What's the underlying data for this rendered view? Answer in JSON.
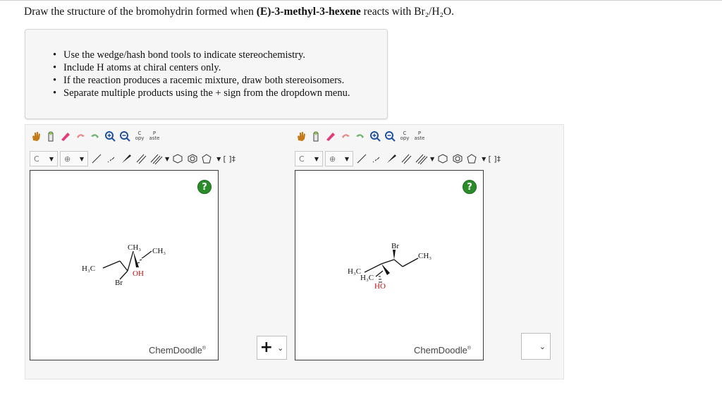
{
  "question": {
    "prefix": "Draw the structure of the bromohydrin formed when ",
    "compound": "(E)-3-methyl-3-hexene",
    "suffix": " reacts with Br₂/H₂O."
  },
  "instructions": [
    "Use the wedge/hash bond tools to indicate stereochemistry.",
    "Include H atoms at chiral centers only.",
    "If the reaction produces a racemic mixture, draw both stereoisomers.",
    "Separate multiple products using the + sign from the dropdown menu."
  ],
  "toolbar": {
    "element_select": "C",
    "charge_symbol": "⊕",
    "copy_top": "C",
    "copy_bottom": "opy",
    "paste_top": "P",
    "paste_bottom": "aste",
    "bracket": "[ ]‡"
  },
  "editor": {
    "help_label": "?",
    "brand": "ChemDoodle",
    "brand_mark": "®"
  },
  "molecule1": {
    "ch3_top": "CH₃",
    "ch3_right": "CH₃",
    "h3c_left": "H₃C",
    "oh": "OH",
    "br": "Br"
  },
  "molecule2": {
    "br": "Br",
    "ch3_right": "CH₃",
    "h3c_left": "H₃C",
    "h3c_inner": "H₃C",
    "ho": "HO"
  },
  "separator": {
    "plus": "+",
    "chevron": "⌄"
  },
  "colors": {
    "help_green": "#2a8d2a",
    "oxygen_red": "#c01010",
    "panel_bg": "#f6f6f6"
  }
}
